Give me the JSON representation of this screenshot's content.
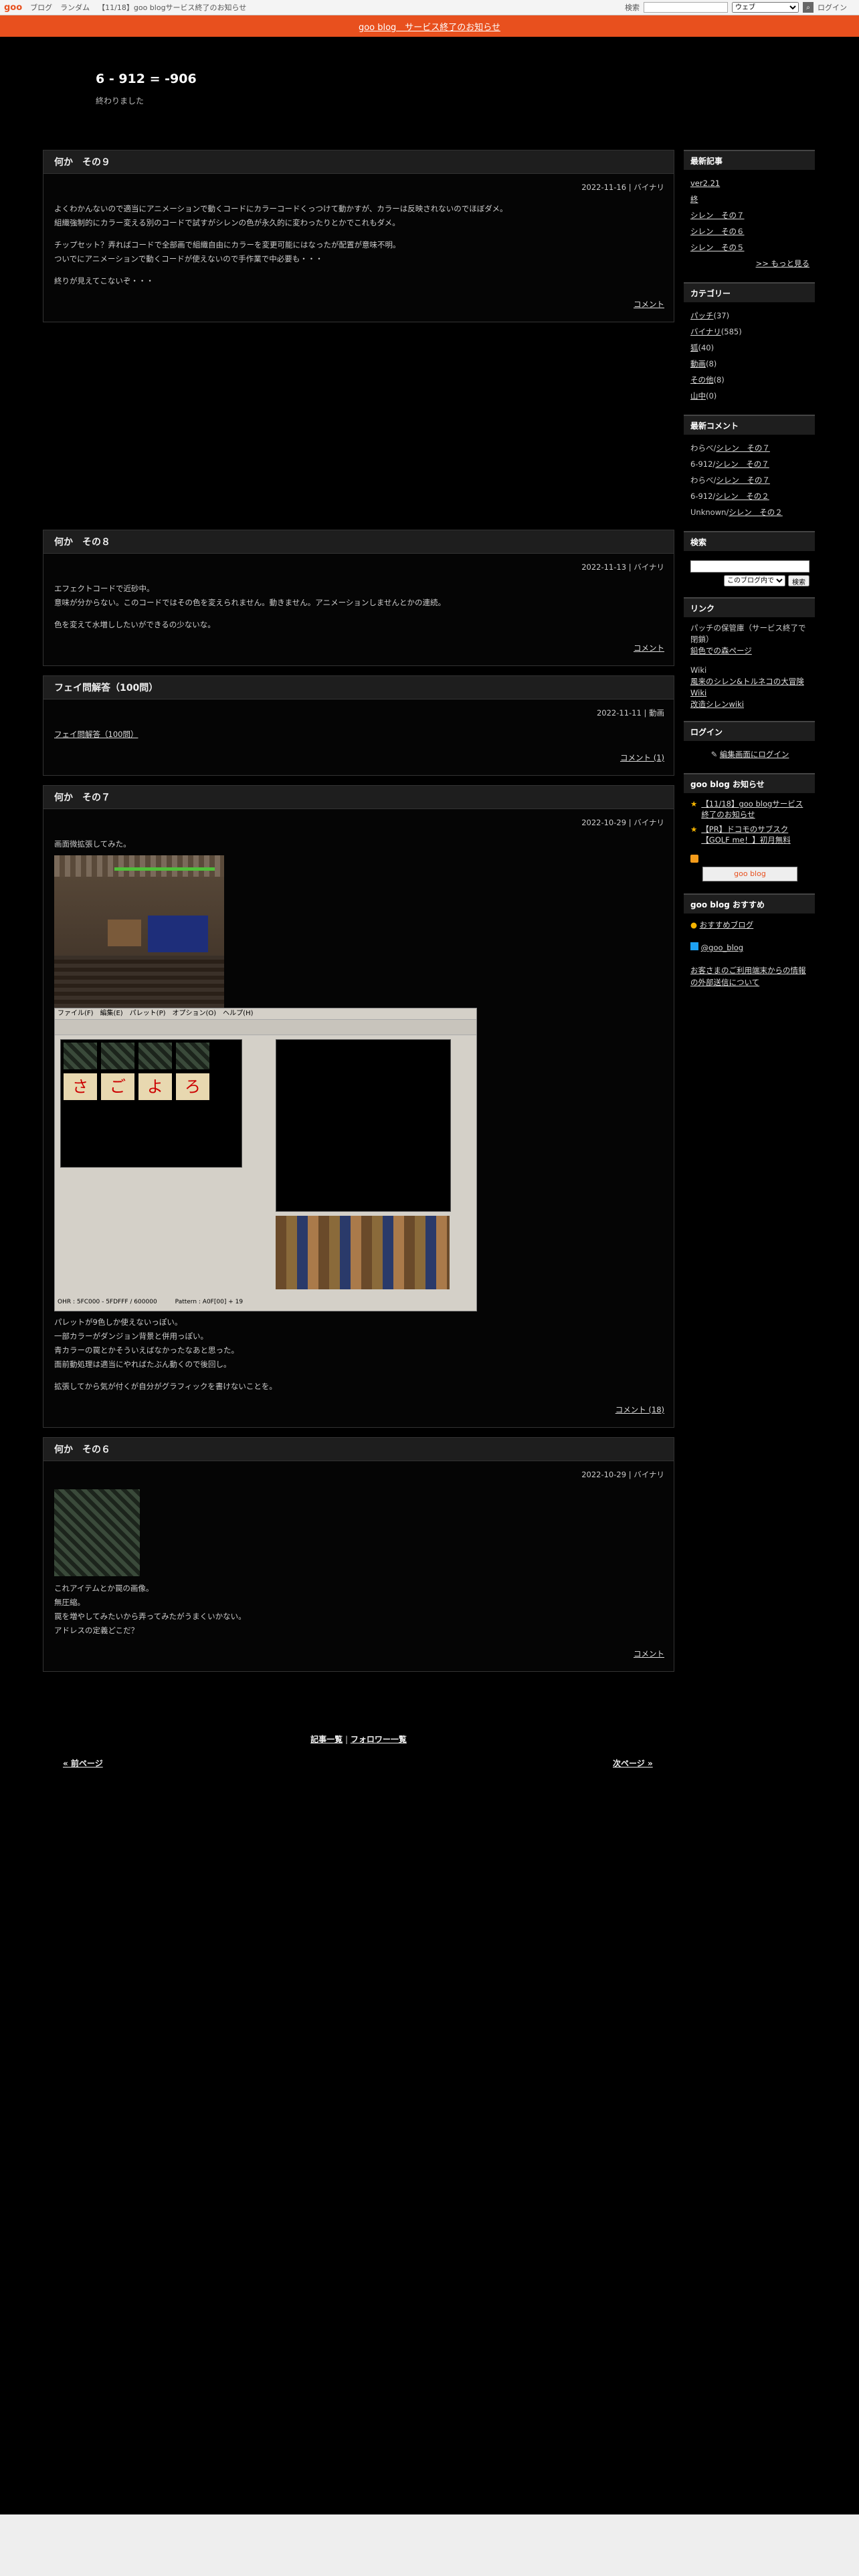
{
  "topbar": {
    "logo": "goo",
    "links": [
      "ブログ",
      "ランダム",
      "【11/18】goo blogサービス終了のお知らせ"
    ],
    "search_label": "検索",
    "search_placeholder": "",
    "search_scope": "ウェブ",
    "go_label": "",
    "login": "ログイン"
  },
  "notice": "goo blog　サービス終了のお知らせ",
  "site": {
    "title": "6 - 912 = -906",
    "description": "終わりました"
  },
  "posts": [
    {
      "title": "何か　その９",
      "meta": "2022-11-16 | バイナリ",
      "lines": [
        "よくわかんないので適当にアニメーションで動くコードにカラーコードくっつけて動かすが、カラーは反映されないのでほぼダメ。",
        "組織強制的にカラー変える別のコードで試すがシレンの色が永久的に変わったりとかでこれもダメ。",
        "",
        "チップセット？弄ればコードで全部画で組織自由にカラーを変更可能にはなったが配置が意味不明。",
        "ついでにアニメーションで動くコードが使えないので手作業で中必要も・・・",
        "",
        "終りが見えてこないぞ・・・"
      ],
      "footer": "コメント"
    },
    {
      "title": "何か　その８",
      "meta": "2022-11-13 | バイナリ",
      "lines": [
        "エフェクトコードで近砂中。",
        "意味が分からない。このコードではその色を変えられません。動きません。アニメーションしませんとかの連続。",
        "",
        "色を変えて水増ししたいができるの少ないな。"
      ],
      "footer": "コメント"
    },
    {
      "title": "フェイ問解答（100問）",
      "meta": "2022-11-11 | 動画",
      "link": "フェイ問解答（100問）",
      "footer": "コメント (1)"
    },
    {
      "title": "何か　その７",
      "meta": "2022-10-29 | バイナリ",
      "intro": "画面微拡張してみた。",
      "tool_menu": "ファイル(F)　編集(E)　パレット(P)　オプション(O)　ヘルプ(H)",
      "tool_status": "OHR : 5FC000 - 5FDFFF / 600000　　　Pattern : A0F[00] + 19",
      "lines": [
        "パレットが9色しか使えないっぽい。",
        "一部カラーがダンジョン背景と併用っぽい。",
        "青カラーの罠とかそういえばなかったなあと思った。",
        "面前動処理は適当にやればたぶん動くので後回し。",
        "",
        "拡張してから気が付くが自分がグラフィックを書けないことを。"
      ],
      "footer": "コメント (18)"
    },
    {
      "title": "何か　その６",
      "meta": "2022-10-29 | バイナリ",
      "lines": [
        "これアイテムとか罠の画像。",
        "無圧縮。",
        "罠を増やしてみたいから弄ってみたがうまくいかない。",
        "アドレスの定義どこだ？"
      ],
      "footer": "コメント"
    }
  ],
  "bottom_nav": {
    "articles": "記事一覧",
    "sep": "|",
    "followers": "フォロワー一覧",
    "prev": "« 前ページ",
    "next": "次ページ »"
  },
  "sidebar": {
    "recent_title": "最新記事",
    "recent": [
      "ver2.21",
      "終",
      "シレン　その７",
      "シレン　その６",
      "シレン　その５"
    ],
    "recent_more": ">> もっと見る",
    "category_title": "カテゴリー",
    "categories": [
      {
        "name": "パッチ",
        "count": "(37)"
      },
      {
        "name": "バイナリ",
        "count": "(585)"
      },
      {
        "name": "狐",
        "count": "(40)"
      },
      {
        "name": "動画",
        "count": "(8)"
      },
      {
        "name": "その他",
        "count": "(8)"
      },
      {
        "name": "山中",
        "count": "(0)"
      }
    ],
    "comments_title": "最新コメント",
    "comments": [
      {
        "who": "わらべ/",
        "post": "シレン　その７"
      },
      {
        "who": "6-912/",
        "post": "シレン　その７"
      },
      {
        "who": "わらべ/",
        "post": "シレン　その７"
      },
      {
        "who": "6-912/",
        "post": "シレン　その２"
      },
      {
        "who": "Unknown/",
        "post": "シレン　その２"
      }
    ],
    "search_title": "検索",
    "search_scope": "このブログ内で",
    "search_button": "検索",
    "link_title": "リンク",
    "links_text1": "パッチの保管庫（サービス終了で閉鎖）",
    "links_link1": "鉛色での森ページ",
    "links_text2": "Wiki",
    "links_link2": "風来のシレン&トルネコの大冒険 Wiki",
    "links_link3": "改造シレンwiki",
    "login_title": "ログイン",
    "login_link": "編集画面にログイン",
    "news_title": "goo blog お知らせ",
    "news": [
      "【11/18】goo blogサービス終了のお知らせ",
      "【PR】ドコモのサブスク【GOLF me！】初月無料"
    ],
    "gooblog_btn": "goo blog",
    "recommend_title": "goo blog おすすめ",
    "recommend_link": "おすすめブログ",
    "twitter": "@goo_blog",
    "ext_info": "お客さまのご利用端末からの情報の外部送信について"
  },
  "colors": {
    "accent": "#e8501e",
    "bg": "#000000",
    "panel": "#1e1e1e"
  }
}
